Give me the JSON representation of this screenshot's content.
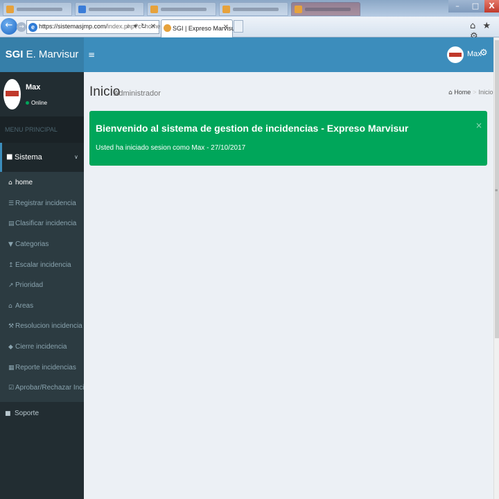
{
  "browser": {
    "url_main": "https://sistemasjmp.com/",
    "url_rest": "index.php?c=home",
    "address_tools": "⌕ ▾ ↻ ✕",
    "active_tab_title": "SGI | Expreso Marvisur",
    "tab_close": "✕",
    "window_minimize": "–",
    "window_maximize": "□",
    "window_close": "X",
    "toolbar_icons": "⌂ ★ ⚙"
  },
  "header": {
    "logo_bold": "SGI",
    "logo_rest": " E. Marvisur",
    "toggle_icon": "≡",
    "user_name": "Max",
    "settings_icon": "⚙"
  },
  "sidebar": {
    "user_name": "Max",
    "status": "Online",
    "menu_header": "MENU PRINCIPAL",
    "sistema": {
      "label": "Sistema",
      "icon": "■",
      "chevron": "∨"
    },
    "items": [
      {
        "icon": "⌂",
        "label": "home",
        "active": true
      },
      {
        "icon": "☰",
        "label": "Registrar incidencia"
      },
      {
        "icon": "▤",
        "label": "Clasificar incidencia"
      },
      {
        "icon": "▼",
        "label": "Categorias"
      },
      {
        "icon": "↥",
        "label": "Escalar incidencia"
      },
      {
        "icon": "↗",
        "label": "Prioridad"
      },
      {
        "icon": "⌂",
        "label": "Areas"
      },
      {
        "icon": "⚒",
        "label": "Resolucion incidencia"
      },
      {
        "icon": "◆",
        "label": "Cierre incidencia"
      },
      {
        "icon": "▦",
        "label": "Reporte incidencias"
      },
      {
        "icon": "☑",
        "label": "Aprobar/Rechazar Incidencia"
      }
    ],
    "soporte": {
      "icon": "■",
      "label": "Soporte"
    }
  },
  "content": {
    "title": "Inicio",
    "subtitle": "Administrador",
    "breadcrumb_home_icon": "⌂",
    "breadcrumb_home": "Home",
    "breadcrumb_sep": ">",
    "breadcrumb_current": "Inicio",
    "alert_title": "Bienvenido al sistema de gestion de incidencias - Expreso Marvisur",
    "alert_text": "Usted ha iniciado sesion como Max - 27/10/2017",
    "alert_close": "×"
  },
  "colors": {
    "header": "#3c8dbc",
    "logo": "#367fa9",
    "sidebar": "#222d32",
    "submenu": "#2c3b41",
    "alert": "#00a65a",
    "content_bg": "#ecf0f5"
  }
}
